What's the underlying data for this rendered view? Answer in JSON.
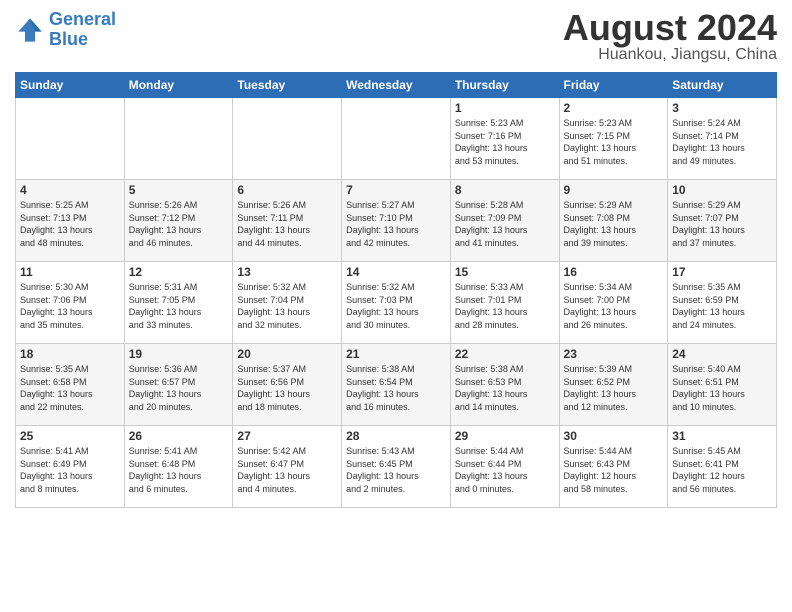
{
  "header": {
    "logo_line1": "General",
    "logo_line2": "Blue",
    "month": "August 2024",
    "location": "Huankou, Jiangsu, China"
  },
  "weekdays": [
    "Sunday",
    "Monday",
    "Tuesday",
    "Wednesday",
    "Thursday",
    "Friday",
    "Saturday"
  ],
  "weeks": [
    [
      {
        "day": "",
        "info": ""
      },
      {
        "day": "",
        "info": ""
      },
      {
        "day": "",
        "info": ""
      },
      {
        "day": "",
        "info": ""
      },
      {
        "day": "1",
        "info": "Sunrise: 5:23 AM\nSunset: 7:16 PM\nDaylight: 13 hours\nand 53 minutes."
      },
      {
        "day": "2",
        "info": "Sunrise: 5:23 AM\nSunset: 7:15 PM\nDaylight: 13 hours\nand 51 minutes."
      },
      {
        "day": "3",
        "info": "Sunrise: 5:24 AM\nSunset: 7:14 PM\nDaylight: 13 hours\nand 49 minutes."
      }
    ],
    [
      {
        "day": "4",
        "info": "Sunrise: 5:25 AM\nSunset: 7:13 PM\nDaylight: 13 hours\nand 48 minutes."
      },
      {
        "day": "5",
        "info": "Sunrise: 5:26 AM\nSunset: 7:12 PM\nDaylight: 13 hours\nand 46 minutes."
      },
      {
        "day": "6",
        "info": "Sunrise: 5:26 AM\nSunset: 7:11 PM\nDaylight: 13 hours\nand 44 minutes."
      },
      {
        "day": "7",
        "info": "Sunrise: 5:27 AM\nSunset: 7:10 PM\nDaylight: 13 hours\nand 42 minutes."
      },
      {
        "day": "8",
        "info": "Sunrise: 5:28 AM\nSunset: 7:09 PM\nDaylight: 13 hours\nand 41 minutes."
      },
      {
        "day": "9",
        "info": "Sunrise: 5:29 AM\nSunset: 7:08 PM\nDaylight: 13 hours\nand 39 minutes."
      },
      {
        "day": "10",
        "info": "Sunrise: 5:29 AM\nSunset: 7:07 PM\nDaylight: 13 hours\nand 37 minutes."
      }
    ],
    [
      {
        "day": "11",
        "info": "Sunrise: 5:30 AM\nSunset: 7:06 PM\nDaylight: 13 hours\nand 35 minutes."
      },
      {
        "day": "12",
        "info": "Sunrise: 5:31 AM\nSunset: 7:05 PM\nDaylight: 13 hours\nand 33 minutes."
      },
      {
        "day": "13",
        "info": "Sunrise: 5:32 AM\nSunset: 7:04 PM\nDaylight: 13 hours\nand 32 minutes."
      },
      {
        "day": "14",
        "info": "Sunrise: 5:32 AM\nSunset: 7:03 PM\nDaylight: 13 hours\nand 30 minutes."
      },
      {
        "day": "15",
        "info": "Sunrise: 5:33 AM\nSunset: 7:01 PM\nDaylight: 13 hours\nand 28 minutes."
      },
      {
        "day": "16",
        "info": "Sunrise: 5:34 AM\nSunset: 7:00 PM\nDaylight: 13 hours\nand 26 minutes."
      },
      {
        "day": "17",
        "info": "Sunrise: 5:35 AM\nSunset: 6:59 PM\nDaylight: 13 hours\nand 24 minutes."
      }
    ],
    [
      {
        "day": "18",
        "info": "Sunrise: 5:35 AM\nSunset: 6:58 PM\nDaylight: 13 hours\nand 22 minutes."
      },
      {
        "day": "19",
        "info": "Sunrise: 5:36 AM\nSunset: 6:57 PM\nDaylight: 13 hours\nand 20 minutes."
      },
      {
        "day": "20",
        "info": "Sunrise: 5:37 AM\nSunset: 6:56 PM\nDaylight: 13 hours\nand 18 minutes."
      },
      {
        "day": "21",
        "info": "Sunrise: 5:38 AM\nSunset: 6:54 PM\nDaylight: 13 hours\nand 16 minutes."
      },
      {
        "day": "22",
        "info": "Sunrise: 5:38 AM\nSunset: 6:53 PM\nDaylight: 13 hours\nand 14 minutes."
      },
      {
        "day": "23",
        "info": "Sunrise: 5:39 AM\nSunset: 6:52 PM\nDaylight: 13 hours\nand 12 minutes."
      },
      {
        "day": "24",
        "info": "Sunrise: 5:40 AM\nSunset: 6:51 PM\nDaylight: 13 hours\nand 10 minutes."
      }
    ],
    [
      {
        "day": "25",
        "info": "Sunrise: 5:41 AM\nSunset: 6:49 PM\nDaylight: 13 hours\nand 8 minutes."
      },
      {
        "day": "26",
        "info": "Sunrise: 5:41 AM\nSunset: 6:48 PM\nDaylight: 13 hours\nand 6 minutes."
      },
      {
        "day": "27",
        "info": "Sunrise: 5:42 AM\nSunset: 6:47 PM\nDaylight: 13 hours\nand 4 minutes."
      },
      {
        "day": "28",
        "info": "Sunrise: 5:43 AM\nSunset: 6:45 PM\nDaylight: 13 hours\nand 2 minutes."
      },
      {
        "day": "29",
        "info": "Sunrise: 5:44 AM\nSunset: 6:44 PM\nDaylight: 13 hours\nand 0 minutes."
      },
      {
        "day": "30",
        "info": "Sunrise: 5:44 AM\nSunset: 6:43 PM\nDaylight: 12 hours\nand 58 minutes."
      },
      {
        "day": "31",
        "info": "Sunrise: 5:45 AM\nSunset: 6:41 PM\nDaylight: 12 hours\nand 56 minutes."
      }
    ]
  ]
}
